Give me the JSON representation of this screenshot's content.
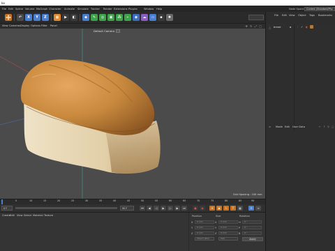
{
  "app": {
    "window_title": "bo"
  },
  "menubar": {
    "items": [
      "File",
      "Edit",
      "Spline",
      "Volume",
      "MoGraph",
      "Character",
      "Animate",
      "Simulate",
      "Tracker",
      "Render",
      "Extensions",
      "Plugins",
      "Window",
      "Help"
    ],
    "layout_label": "Node Space:",
    "layout_value": "Current (Standard/Phy"
  },
  "viewport_header": {
    "menus": [
      "View",
      "Cameras",
      "Display",
      "Options",
      "Filter",
      "Panel"
    ],
    "camera_label": "Default Camera"
  },
  "viewport": {
    "grid_spacing": "Grid Spacing : 100 mm"
  },
  "timeline": {
    "ticks": [
      "0",
      "5",
      "10",
      "15",
      "20",
      "25",
      "30",
      "35",
      "40",
      "45",
      "50",
      "55",
      "60",
      "65",
      "70",
      "75",
      "80",
      "85",
      "90"
    ]
  },
  "transport": {
    "start_frame": "0 F",
    "current_frame": "0 F",
    "end_frame": "90 F"
  },
  "attr_panel": {
    "tabs": [
      "Create",
      "Edit",
      "View",
      "Select",
      "Material",
      "Texture"
    ],
    "coord_tabs": [
      "Position",
      "Size",
      "Rotation"
    ],
    "rows": [
      {
        "axis": "X",
        "pos": "0 mm",
        "size_axis": "X",
        "size": "0 mm",
        "rot_axis": "H",
        "rot": "0 °"
      },
      {
        "axis": "Y",
        "pos": "0 mm",
        "size_axis": "Y",
        "size": "0 mm",
        "rot_axis": "P",
        "rot": "0 °"
      },
      {
        "axis": "Z",
        "pos": "0 mm",
        "size_axis": "Z",
        "size": "0 mm",
        "rot_axis": "B",
        "rot": "0 °"
      }
    ],
    "dropdown_object": "Object (Rel)",
    "dropdown_size": "Size",
    "apply_label": "Apply"
  },
  "right_panel": {
    "top_menus": [
      "File",
      "Edit",
      "View",
      "Object",
      "Tags",
      "Bookmarks"
    ],
    "object_name": "bread",
    "attr_menus": [
      "Mode",
      "Edit",
      "User Data"
    ]
  },
  "colors": {
    "accent_blue": "#4a7fd0",
    "accent_orange": "#e08a2c",
    "accent_green": "#3ea34a",
    "viewport_bg": "#4b4b4b"
  }
}
